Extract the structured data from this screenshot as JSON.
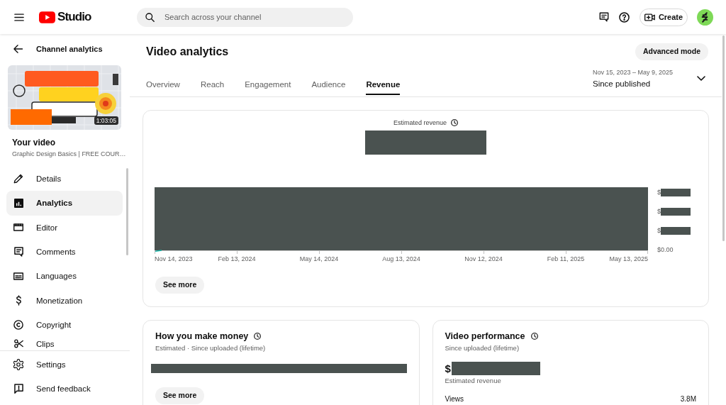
{
  "topbar": {
    "app_name": "Studio",
    "search": {
      "placeholder": "Search across your channel"
    },
    "create_button": "Create"
  },
  "sidebar": {
    "back_link": "Channel analytics",
    "video": {
      "duration": "1:03:05",
      "heading": "Your video",
      "title": "Graphic Design Basics | FREE COUR…"
    },
    "nav_items": [
      {
        "label": "Details",
        "selected": false
      },
      {
        "label": "Analytics",
        "selected": true
      },
      {
        "label": "Editor",
        "selected": false
      },
      {
        "label": "Comments",
        "selected": false
      },
      {
        "label": "Languages",
        "selected": false
      },
      {
        "label": "Monetization",
        "selected": false
      },
      {
        "label": "Copyright",
        "selected": false
      },
      {
        "label": "Clips",
        "selected": false
      }
    ],
    "footer_items": [
      {
        "label": "Settings"
      },
      {
        "label": "Send feedback"
      }
    ]
  },
  "page": {
    "title": "Video analytics",
    "advanced_button": "Advanced mode",
    "tabs": [
      {
        "label": "Overview",
        "selected": false
      },
      {
        "label": "Reach",
        "selected": false
      },
      {
        "label": "Engagement",
        "selected": false
      },
      {
        "label": "Audience",
        "selected": false
      },
      {
        "label": "Revenue",
        "selected": true
      }
    ],
    "date_range": {
      "range": "Nov 15, 2023 – May 9, 2025",
      "label": "Since published"
    }
  },
  "revenue_card": {
    "metric": "Estimated revenue",
    "total": {
      "redacted": true
    },
    "chart": {
      "redacted": true,
      "x_labels": [
        "Nov 14, 2023",
        "Feb 13, 2024",
        "May 14, 2024",
        "Aug 13, 2024",
        "Nov 12, 2024",
        "Feb 11, 2025",
        "May 13, 2025"
      ],
      "y_labels": [
        {
          "text": "$",
          "redacted": true
        },
        {
          "text": "$",
          "redacted": true
        },
        {
          "text": "$",
          "redacted": true
        },
        {
          "text": "$0.00",
          "redacted": false
        }
      ]
    },
    "button": "See more"
  },
  "cards": [
    {
      "kind": "breakdown",
      "title": "How you make money",
      "subtitle": "Estimated · Since uploaded (lifetime)",
      "breakdown": {
        "redacted": true
      },
      "button": "See more"
    },
    {
      "kind": "performance",
      "title": "Video performance",
      "subtitle": "Since uploaded (lifetime)",
      "amount": {
        "text": "$",
        "redacted": true
      },
      "amount_label": "Estimated revenue",
      "rows": [
        {
          "label": "Views",
          "value": "3.8M"
        }
      ]
    }
  ]
}
